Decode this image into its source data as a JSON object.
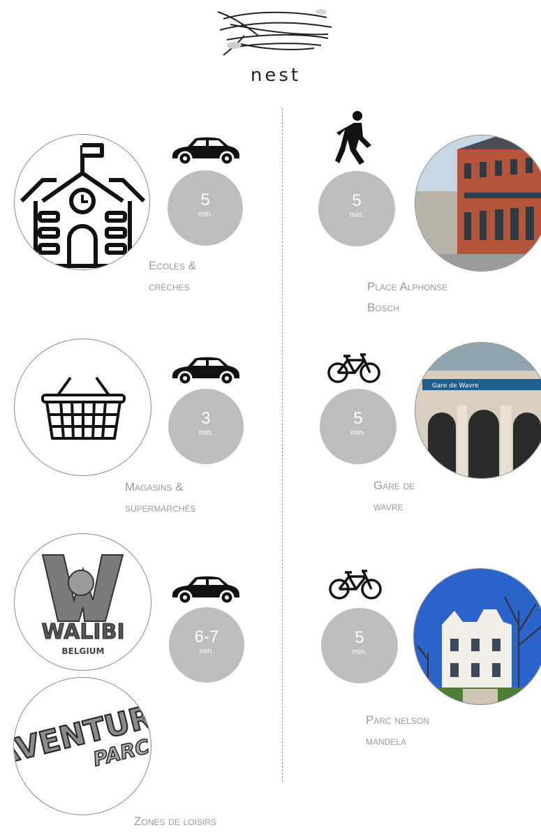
{
  "brand": {
    "name": "nest"
  },
  "left_column": [
    {
      "time": "5",
      "unit": "min.",
      "transport": "car",
      "label_line1": "Ecoles &",
      "label_line2": "crèches"
    },
    {
      "time": "3",
      "unit": "min.",
      "transport": "car",
      "label_line1": "Magasins &",
      "label_line2": "supermarchés"
    },
    {
      "time": "6-7",
      "unit": "min.",
      "transport": "car",
      "label_line1": "Zones de loisirs",
      "label_line2": "",
      "logo1_text": "WALIBI",
      "logo1_sub": "BELGIUM",
      "logo2_text1": "AVENTURE",
      "logo2_text2": "PARC"
    }
  ],
  "right_column": [
    {
      "time": "5",
      "unit": "min.",
      "transport": "walk",
      "label_line1": "Place Alphonse",
      "label_line2": "Bosch"
    },
    {
      "time": "5",
      "unit": "min.",
      "transport": "bike",
      "label_line1": "Gare de",
      "label_line2": "wavre",
      "sign_text": "Gare de Wavre"
    },
    {
      "time": "5",
      "unit": "min.",
      "transport": "bike",
      "label_line1": "Parc nelson",
      "label_line2": "mandela"
    }
  ],
  "colors": {
    "time_bubble": "#bdbdbd",
    "label": "#9a9a9a",
    "divider": "#9a9a9a"
  }
}
